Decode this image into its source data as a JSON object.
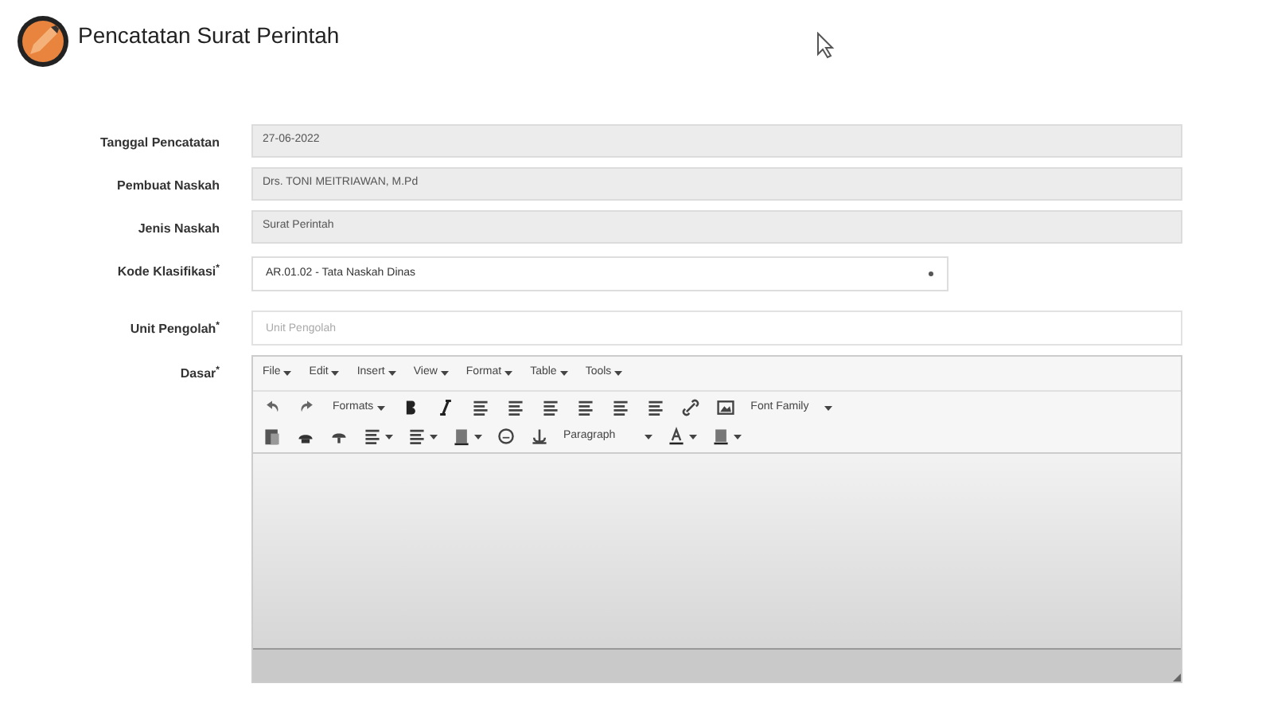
{
  "page": {
    "title": "Pencatatan Surat Perintah"
  },
  "fields": [
    {
      "kind": "readonly",
      "label": "Tanggal Pencatatan",
      "value": "27-06-2022"
    },
    {
      "kind": "readonly",
      "label": "Pembuat Naskah",
      "value": "Drs. TONI MEITRIAWAN, M.Pd"
    },
    {
      "kind": "readonly",
      "label": "Jenis Naskah",
      "value": "Surat Perintah"
    },
    {
      "kind": "select",
      "label": "Kode Klasifikasi$^{*}$",
      "value": "AR.01.02 - Tata Naskah Dinas"
    },
    {
      "kind": "input",
      "label": "Unit Pengolah$^{*}$",
      "placeholder": "Unit Pengolah"
    },
    {
      "kind": "editor",
      "label": "Dasar$^{*}$",
      "menus": [
        "File",
        "Edit",
        "Insert",
        "View",
        "Format",
        "Table",
        "Tools"
      ],
      "formats": "Formats",
      "font_family": "Font Family",
      "block_format": "Paragraph"
    }
  ]
}
